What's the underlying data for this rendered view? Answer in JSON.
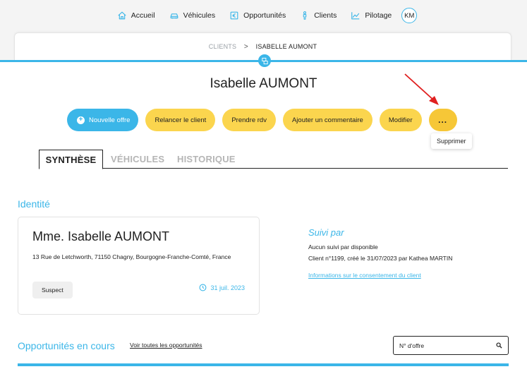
{
  "nav": {
    "items": [
      {
        "label": "Accueil",
        "icon": "home-icon"
      },
      {
        "label": "Véhicules",
        "icon": "car-icon"
      },
      {
        "label": "Opportunités",
        "icon": "euro-icon"
      },
      {
        "label": "Clients",
        "icon": "person-icon"
      },
      {
        "label": "Pilotage",
        "icon": "chart-icon"
      }
    ],
    "avatar": "KM"
  },
  "breadcrumb": {
    "root": "CLIENTS",
    "separator": ">",
    "current": "ISABELLE AUMONT"
  },
  "page_title": "Isabelle AUMONT",
  "actions": {
    "new_offer": "Nouvelle offre",
    "relaunch": "Relancer le client",
    "appointment": "Prendre rdv",
    "comment": "Ajouter un commentaire",
    "edit": "Modifier",
    "more": "..."
  },
  "tooltip": "Supprimer",
  "tabs": [
    {
      "label": "SYNTHÈSE",
      "active": true
    },
    {
      "label": "VÉHICULES",
      "active": false
    },
    {
      "label": "HISTORIQUE",
      "active": false
    }
  ],
  "identity": {
    "section_title": "Identité",
    "name": "Mme. Isabelle AUMONT",
    "address": "13 Rue de Letchworth, 71150 Chagny, Bourgogne-Franche-Comté, France",
    "status": "Suspect",
    "date": "31 juil. 2023"
  },
  "suivi": {
    "title": "Suivi par",
    "line1": "Aucun suivi par disponible",
    "line2": "Client n°1199, créé le 31/07/2023 par Kathea MARTIN",
    "consent_link": "Informations sur le consentement du client"
  },
  "opportunities": {
    "section_title": "Opportunités en cours",
    "see_all": "Voir toutes les opportunités",
    "search_placeholder": "N° d'offre"
  },
  "colors": {
    "accent": "#3bb6e8",
    "button": "#fbd54e",
    "arrow": "#e02020"
  }
}
